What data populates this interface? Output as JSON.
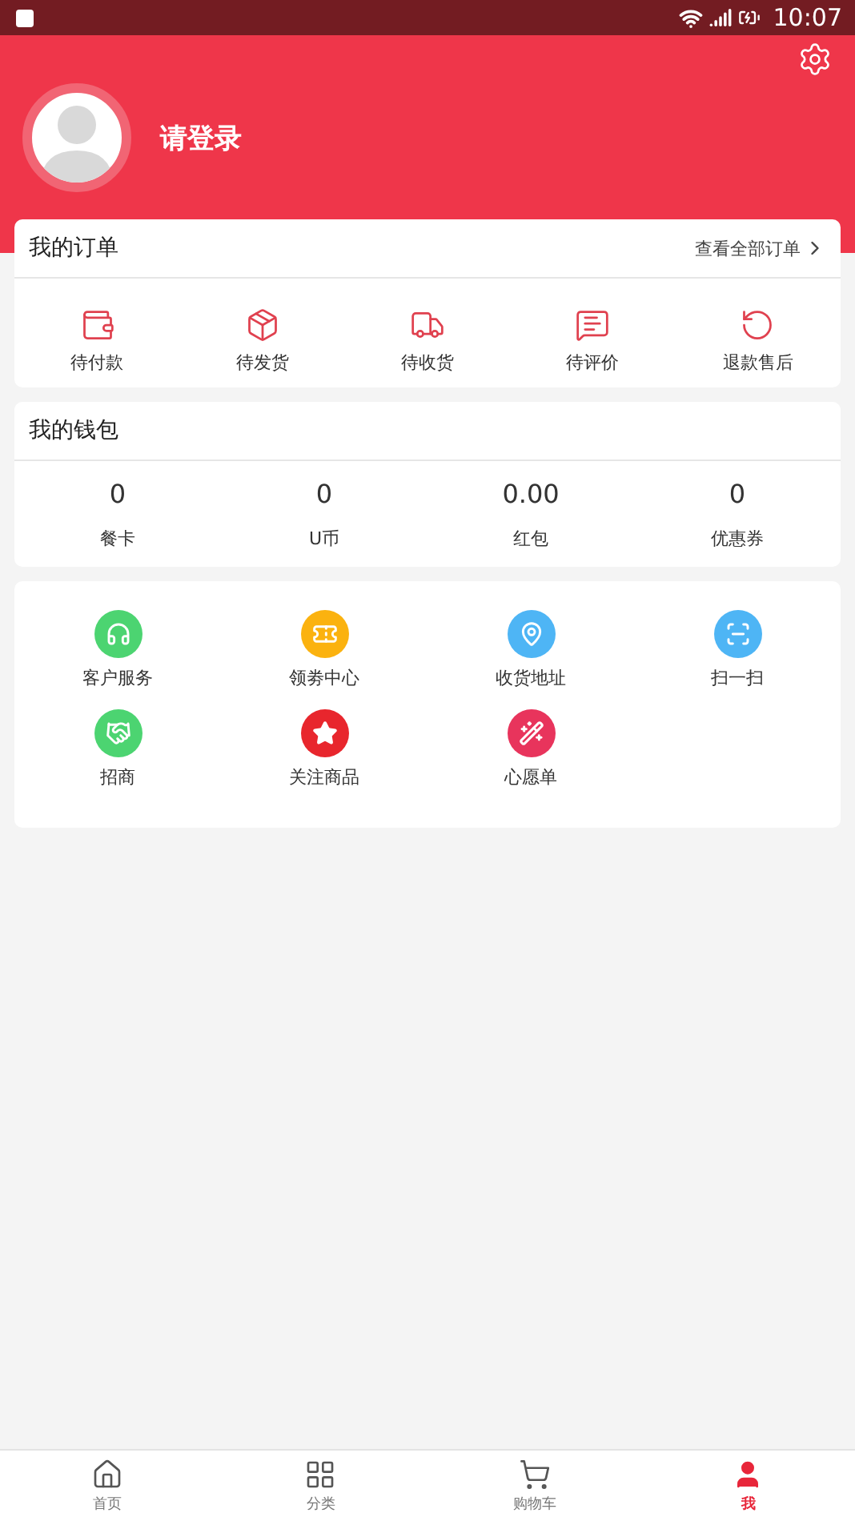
{
  "status_bar": {
    "time": "10:07"
  },
  "profile": {
    "login_text": "请登录"
  },
  "orders": {
    "title": "我的订单",
    "view_all": "查看全部订单",
    "items": [
      {
        "kind": "wallet",
        "label": "待付款"
      },
      {
        "kind": "package",
        "label": "待发货"
      },
      {
        "kind": "truck",
        "label": "待收货"
      },
      {
        "kind": "comment",
        "label": "待评价"
      },
      {
        "kind": "refund",
        "label": "退款售后"
      }
    ]
  },
  "wallet": {
    "title": "我的钱包",
    "items": [
      {
        "value": "0",
        "label": "餐卡"
      },
      {
        "value": "0",
        "label": "U币"
      },
      {
        "value": "0.00",
        "label": "红包"
      },
      {
        "value": "0",
        "label": "优惠券"
      }
    ]
  },
  "services": [
    {
      "kind": "headset",
      "label": "客户服务",
      "color": "#4cd471"
    },
    {
      "kind": "ticket",
      "label": "领劵中心",
      "color": "#fbb20f"
    },
    {
      "kind": "pin",
      "label": "收货地址",
      "color": "#4eb5f5"
    },
    {
      "kind": "scan",
      "label": "扫一扫",
      "color": "#4eb5f5"
    },
    {
      "kind": "handshake",
      "label": "招商",
      "color": "#4cd471"
    },
    {
      "kind": "star",
      "label": "关注商品",
      "color": "#e8262d"
    },
    {
      "kind": "wand",
      "label": "心愿单",
      "color": "#e8345c"
    }
  ],
  "tab_bar": [
    {
      "kind": "home",
      "label": "首页",
      "selected": false
    },
    {
      "kind": "grid",
      "label": "分类",
      "selected": false
    },
    {
      "kind": "cart",
      "label": "购物车",
      "selected": false
    },
    {
      "kind": "user",
      "label": "我",
      "selected": true
    }
  ]
}
